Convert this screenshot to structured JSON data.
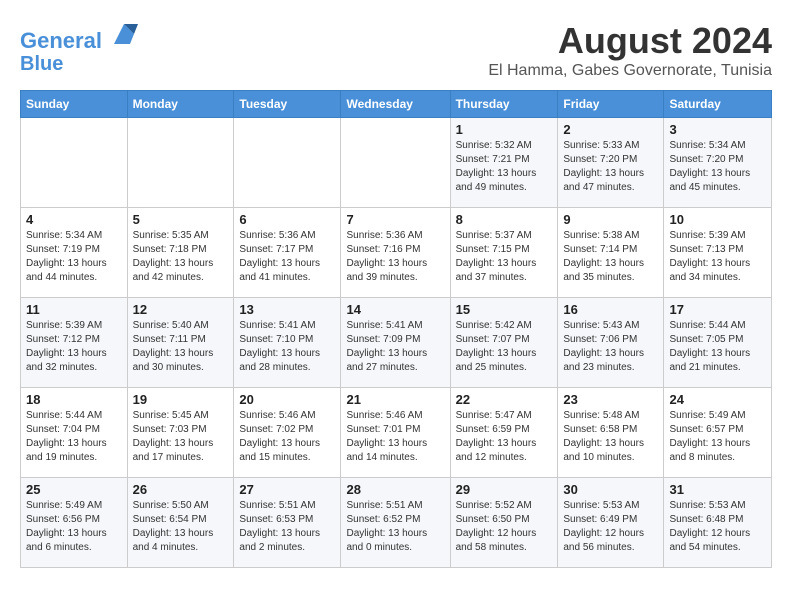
{
  "logo": {
    "line1": "General",
    "line2": "Blue"
  },
  "title": "August 2024",
  "location": "El Hamma, Gabes Governorate, Tunisia",
  "weekdays": [
    "Sunday",
    "Monday",
    "Tuesday",
    "Wednesday",
    "Thursday",
    "Friday",
    "Saturday"
  ],
  "weeks": [
    [
      {
        "day": "",
        "sunrise": "",
        "sunset": "",
        "daylight": ""
      },
      {
        "day": "",
        "sunrise": "",
        "sunset": "",
        "daylight": ""
      },
      {
        "day": "",
        "sunrise": "",
        "sunset": "",
        "daylight": ""
      },
      {
        "day": "",
        "sunrise": "",
        "sunset": "",
        "daylight": ""
      },
      {
        "day": "1",
        "sunrise": "Sunrise: 5:32 AM",
        "sunset": "Sunset: 7:21 PM",
        "daylight": "Daylight: 13 hours and 49 minutes."
      },
      {
        "day": "2",
        "sunrise": "Sunrise: 5:33 AM",
        "sunset": "Sunset: 7:20 PM",
        "daylight": "Daylight: 13 hours and 47 minutes."
      },
      {
        "day": "3",
        "sunrise": "Sunrise: 5:34 AM",
        "sunset": "Sunset: 7:20 PM",
        "daylight": "Daylight: 13 hours and 45 minutes."
      }
    ],
    [
      {
        "day": "4",
        "sunrise": "Sunrise: 5:34 AM",
        "sunset": "Sunset: 7:19 PM",
        "daylight": "Daylight: 13 hours and 44 minutes."
      },
      {
        "day": "5",
        "sunrise": "Sunrise: 5:35 AM",
        "sunset": "Sunset: 7:18 PM",
        "daylight": "Daylight: 13 hours and 42 minutes."
      },
      {
        "day": "6",
        "sunrise": "Sunrise: 5:36 AM",
        "sunset": "Sunset: 7:17 PM",
        "daylight": "Daylight: 13 hours and 41 minutes."
      },
      {
        "day": "7",
        "sunrise": "Sunrise: 5:36 AM",
        "sunset": "Sunset: 7:16 PM",
        "daylight": "Daylight: 13 hours and 39 minutes."
      },
      {
        "day": "8",
        "sunrise": "Sunrise: 5:37 AM",
        "sunset": "Sunset: 7:15 PM",
        "daylight": "Daylight: 13 hours and 37 minutes."
      },
      {
        "day": "9",
        "sunrise": "Sunrise: 5:38 AM",
        "sunset": "Sunset: 7:14 PM",
        "daylight": "Daylight: 13 hours and 35 minutes."
      },
      {
        "day": "10",
        "sunrise": "Sunrise: 5:39 AM",
        "sunset": "Sunset: 7:13 PM",
        "daylight": "Daylight: 13 hours and 34 minutes."
      }
    ],
    [
      {
        "day": "11",
        "sunrise": "Sunrise: 5:39 AM",
        "sunset": "Sunset: 7:12 PM",
        "daylight": "Daylight: 13 hours and 32 minutes."
      },
      {
        "day": "12",
        "sunrise": "Sunrise: 5:40 AM",
        "sunset": "Sunset: 7:11 PM",
        "daylight": "Daylight: 13 hours and 30 minutes."
      },
      {
        "day": "13",
        "sunrise": "Sunrise: 5:41 AM",
        "sunset": "Sunset: 7:10 PM",
        "daylight": "Daylight: 13 hours and 28 minutes."
      },
      {
        "day": "14",
        "sunrise": "Sunrise: 5:41 AM",
        "sunset": "Sunset: 7:09 PM",
        "daylight": "Daylight: 13 hours and 27 minutes."
      },
      {
        "day": "15",
        "sunrise": "Sunrise: 5:42 AM",
        "sunset": "Sunset: 7:07 PM",
        "daylight": "Daylight: 13 hours and 25 minutes."
      },
      {
        "day": "16",
        "sunrise": "Sunrise: 5:43 AM",
        "sunset": "Sunset: 7:06 PM",
        "daylight": "Daylight: 13 hours and 23 minutes."
      },
      {
        "day": "17",
        "sunrise": "Sunrise: 5:44 AM",
        "sunset": "Sunset: 7:05 PM",
        "daylight": "Daylight: 13 hours and 21 minutes."
      }
    ],
    [
      {
        "day": "18",
        "sunrise": "Sunrise: 5:44 AM",
        "sunset": "Sunset: 7:04 PM",
        "daylight": "Daylight: 13 hours and 19 minutes."
      },
      {
        "day": "19",
        "sunrise": "Sunrise: 5:45 AM",
        "sunset": "Sunset: 7:03 PM",
        "daylight": "Daylight: 13 hours and 17 minutes."
      },
      {
        "day": "20",
        "sunrise": "Sunrise: 5:46 AM",
        "sunset": "Sunset: 7:02 PM",
        "daylight": "Daylight: 13 hours and 15 minutes."
      },
      {
        "day": "21",
        "sunrise": "Sunrise: 5:46 AM",
        "sunset": "Sunset: 7:01 PM",
        "daylight": "Daylight: 13 hours and 14 minutes."
      },
      {
        "day": "22",
        "sunrise": "Sunrise: 5:47 AM",
        "sunset": "Sunset: 6:59 PM",
        "daylight": "Daylight: 13 hours and 12 minutes."
      },
      {
        "day": "23",
        "sunrise": "Sunrise: 5:48 AM",
        "sunset": "Sunset: 6:58 PM",
        "daylight": "Daylight: 13 hours and 10 minutes."
      },
      {
        "day": "24",
        "sunrise": "Sunrise: 5:49 AM",
        "sunset": "Sunset: 6:57 PM",
        "daylight": "Daylight: 13 hours and 8 minutes."
      }
    ],
    [
      {
        "day": "25",
        "sunrise": "Sunrise: 5:49 AM",
        "sunset": "Sunset: 6:56 PM",
        "daylight": "Daylight: 13 hours and 6 minutes."
      },
      {
        "day": "26",
        "sunrise": "Sunrise: 5:50 AM",
        "sunset": "Sunset: 6:54 PM",
        "daylight": "Daylight: 13 hours and 4 minutes."
      },
      {
        "day": "27",
        "sunrise": "Sunrise: 5:51 AM",
        "sunset": "Sunset: 6:53 PM",
        "daylight": "Daylight: 13 hours and 2 minutes."
      },
      {
        "day": "28",
        "sunrise": "Sunrise: 5:51 AM",
        "sunset": "Sunset: 6:52 PM",
        "daylight": "Daylight: 13 hours and 0 minutes."
      },
      {
        "day": "29",
        "sunrise": "Sunrise: 5:52 AM",
        "sunset": "Sunset: 6:50 PM",
        "daylight": "Daylight: 12 hours and 58 minutes."
      },
      {
        "day": "30",
        "sunrise": "Sunrise: 5:53 AM",
        "sunset": "Sunset: 6:49 PM",
        "daylight": "Daylight: 12 hours and 56 minutes."
      },
      {
        "day": "31",
        "sunrise": "Sunrise: 5:53 AM",
        "sunset": "Sunset: 6:48 PM",
        "daylight": "Daylight: 12 hours and 54 minutes."
      }
    ]
  ]
}
